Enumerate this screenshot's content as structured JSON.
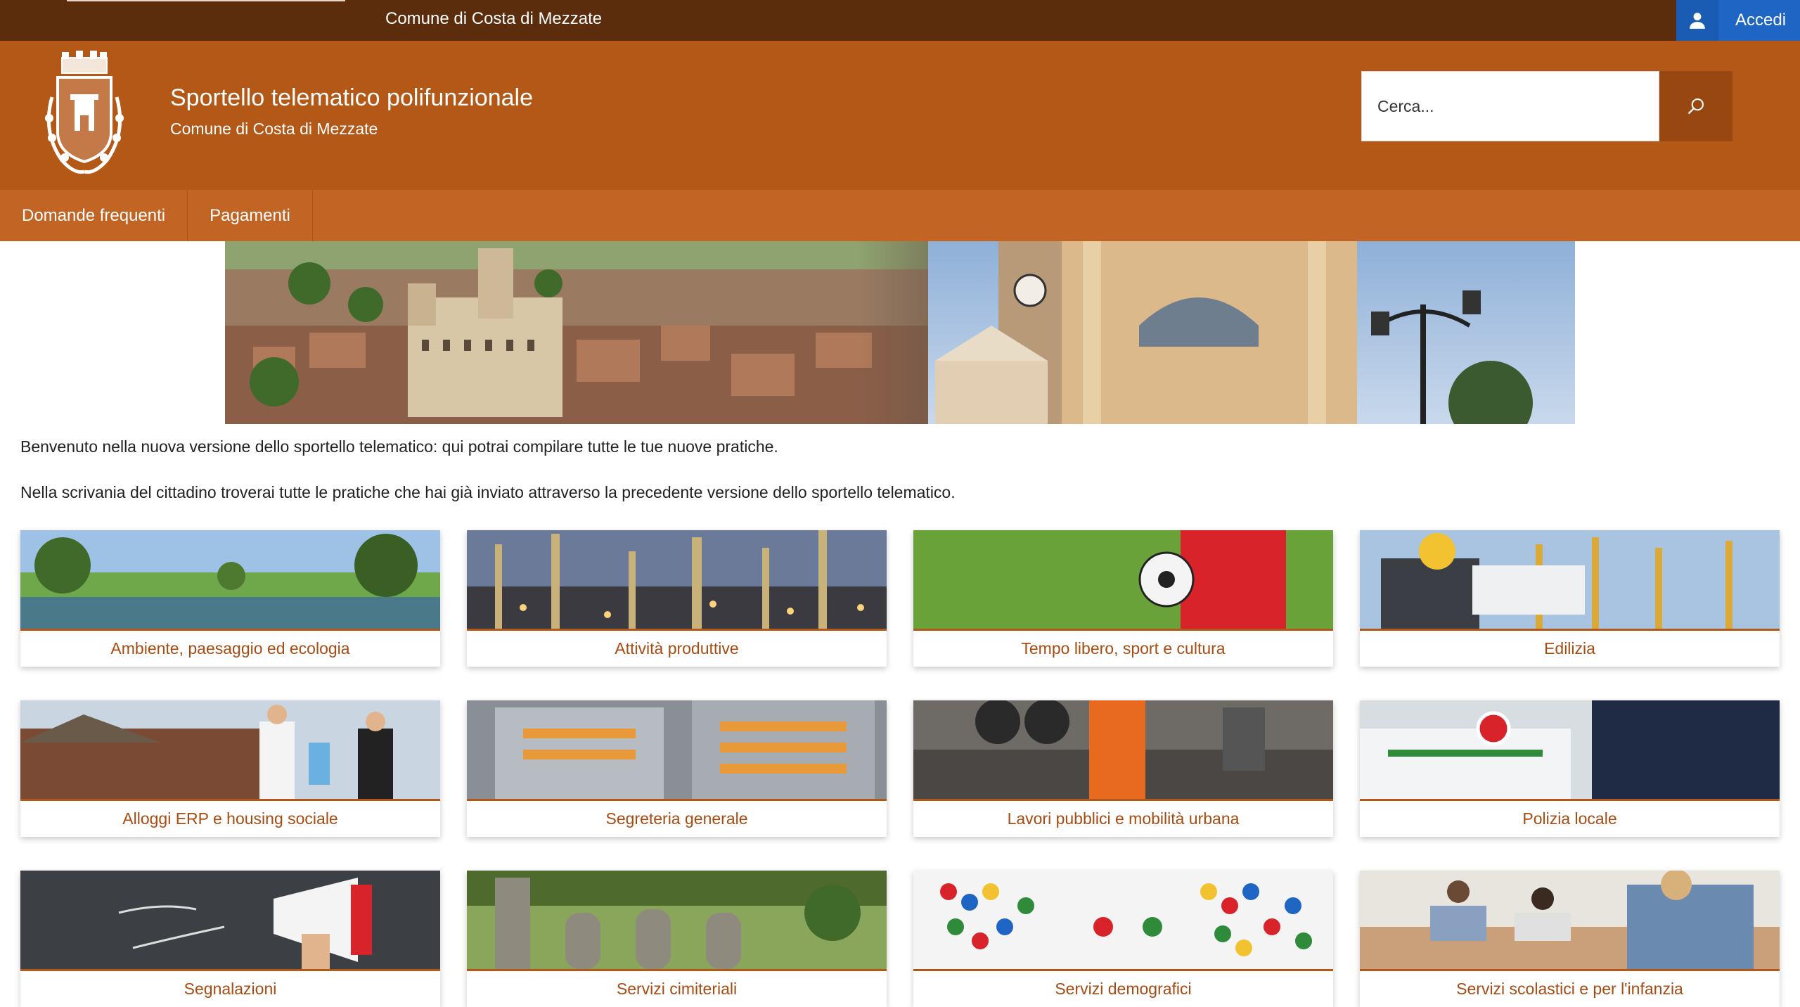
{
  "topbar": {
    "municipality": "Comune di Costa di Mezzate",
    "login_label": "Accedi",
    "login_icon": "user-icon"
  },
  "header": {
    "title": "Sportello telematico polifunzionale",
    "subtitle": "Comune di Costa di Mezzate",
    "crest_icon": "municipal-crest-icon",
    "search_placeholder": "Cerca...",
    "search_icon": "search-icon"
  },
  "nav": {
    "items": [
      {
        "label": "Domande frequenti"
      },
      {
        "label": "Pagamenti"
      }
    ]
  },
  "intro": {
    "line1": "Benvenuto nella nuova versione dello sportello telematico: qui potrai compilare tutte le tue nuove pratiche.",
    "line2": "Nella scrivania del cittadino troverai tutte le pratiche che hai già inviato attraverso la precedente versione dello sportello telematico."
  },
  "categories": [
    {
      "label": "Ambiente, paesaggio ed ecologia"
    },
    {
      "label": "Attività produttive"
    },
    {
      "label": "Tempo libero, sport e cultura"
    },
    {
      "label": "Edilizia"
    },
    {
      "label": "Alloggi ERP e housing sociale"
    },
    {
      "label": "Segreteria generale"
    },
    {
      "label": "Lavori pubblici e mobilità urbana"
    },
    {
      "label": "Polizia locale"
    },
    {
      "label": "Segnalazioni"
    },
    {
      "label": "Servizi cimiteriali"
    },
    {
      "label": "Servizi demografici"
    },
    {
      "label": "Servizi scolastici e per l'infanzia"
    }
  ],
  "colors": {
    "topbar": "#5b2d0c",
    "header": "#b45817",
    "nav": "#c16424",
    "login": "#1f65c3",
    "card_label": "#a54c14"
  }
}
